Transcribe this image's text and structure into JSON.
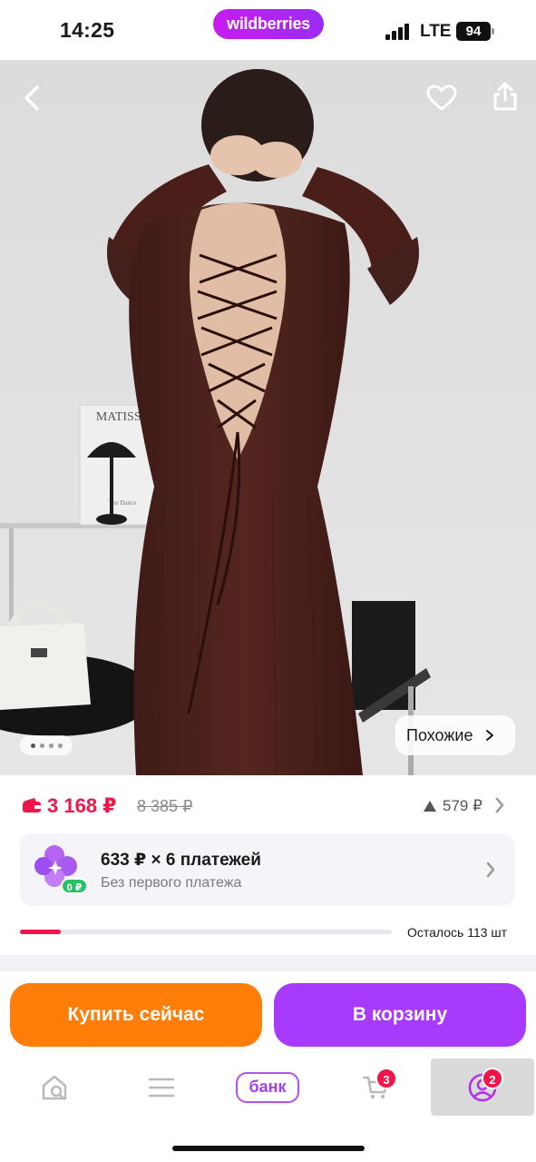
{
  "status_bar": {
    "time": "14:25",
    "network": "LTE",
    "battery": "94"
  },
  "brand": {
    "name": "wildberries",
    "color": "#b520f2"
  },
  "product_image": {
    "poster_text": "MATISSE",
    "poster_subtext": "The Dance",
    "back_icon": "chevron-left-icon",
    "favorite_icon": "heart-icon",
    "share_icon": "share-icon",
    "similar_label": "Похожие",
    "gallery_pages": 4,
    "gallery_active": 1
  },
  "price": {
    "current": "3 168 ₽",
    "old": "8 385 ₽",
    "change": "579 ₽",
    "color": "#f0164a"
  },
  "installment": {
    "title": "633 ₽ × 6 платежей",
    "subtitle": "Без первого платежа",
    "badge": "0 ₽"
  },
  "stock": {
    "label": "Осталось 113 шт",
    "fill_fraction": 0.11
  },
  "actions": {
    "buy_now": "Купить сейчас",
    "add_to_cart": "В корзину",
    "buy_color": "#ff7e0a",
    "cart_color": "#a73afd"
  },
  "tab_bar": {
    "bank_label": "банк",
    "cart_badge": "3",
    "profile_badge": "2"
  }
}
